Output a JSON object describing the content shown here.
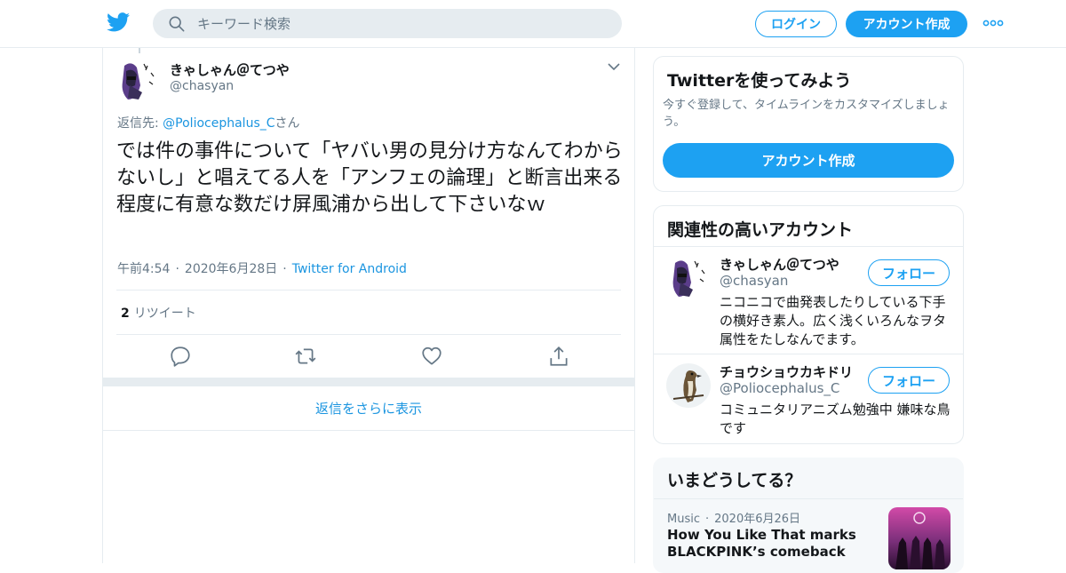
{
  "header": {
    "search_placeholder": "キーワード検索",
    "login_label": "ログイン",
    "signup_label": "アカウント作成",
    "brand_color": "#1da1f2"
  },
  "tweet": {
    "display_name": "きゃしゃん＠てつや",
    "handle": "@chasyan",
    "reply_prefix": "返信先: ",
    "reply_to": "@Poliocephalus_C",
    "reply_suffix": "さん",
    "text": "では件の事件について「ヤバい男の見分け方なんてわからないし」と唱えてる人を「アンフェの論理」と断言出来る程度に有意な数だけ屏風浦から出して下さいなｗ",
    "time": "午前4:54",
    "date": "2020年6月28日",
    "source": "Twitter for Android",
    "retweet_count": "2",
    "retweet_label": "リツイート",
    "actions": [
      "reply-icon",
      "retweet-icon",
      "like-icon",
      "share-icon"
    ],
    "show_more_replies": "返信をさらに表示"
  },
  "sidebar": {
    "signup_card": {
      "title": "Twitterを使ってみよう",
      "description": "今すぐ登録して、タイムラインをカスタマイズしましょう。",
      "button": "アカウント作成"
    },
    "related": {
      "title": "関連性の高いアカウント",
      "accounts": [
        {
          "name": "きゃしゃん＠てつや",
          "handle": "@chasyan",
          "bio": "ニコニコで曲発表したりしている下手の横好き素人。広く浅くいろんなヲタ属性をたしなんでます。",
          "follow": "フォロー"
        },
        {
          "name": "チョウショウカキドリ",
          "handle": "@Poliocephalus_C",
          "bio": "コミュニタリアニズム勉強中 嫌味な鳥です",
          "follow": "フォロー"
        }
      ]
    },
    "trends": {
      "title": "いまどうしてる？",
      "item": {
        "category": "Music",
        "date": "2020年6月26日",
        "title": "How You Like That marks BLACKPINK’s comeback"
      }
    }
  }
}
